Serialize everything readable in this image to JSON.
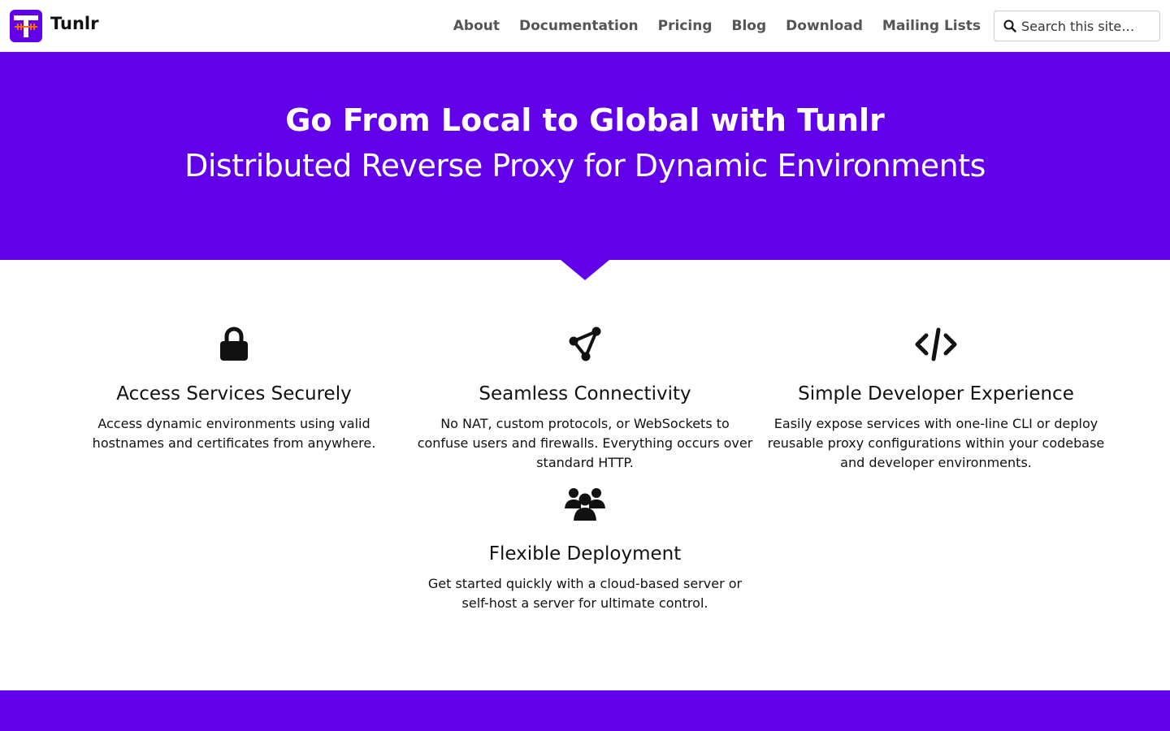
{
  "site": {
    "name": "Tunlr",
    "logo_icon": "tunlr-logo-icon",
    "brand_color": "#6200ea",
    "logo_accent_color": "#ff6d00"
  },
  "nav": {
    "items": [
      {
        "label": "About"
      },
      {
        "label": "Documentation"
      },
      {
        "label": "Pricing"
      },
      {
        "label": "Blog"
      },
      {
        "label": "Download"
      },
      {
        "label": "Mailing Lists"
      }
    ]
  },
  "search": {
    "placeholder": "Search this site…",
    "icon": "search-icon"
  },
  "hero": {
    "title": "Go From Local to Global with Tunlr",
    "subtitle": "Distributed Reverse Proxy for Dynamic Environments"
  },
  "features": [
    {
      "icon": "lock-icon",
      "title": "Access Services Securely",
      "text": "Access dynamic environments using valid hostnames and certificates from anywhere."
    },
    {
      "icon": "connectivity-icon",
      "title": "Seamless Connectivity",
      "text": "No NAT, custom protocols, or WebSockets to confuse users and firewalls. Everything occurs over standard HTTP."
    },
    {
      "icon": "code-icon",
      "title": "Simple Developer Experience",
      "text": "Easily expose services with one-line CLI or deploy reusable proxy configurations within your codebase and developer environments."
    },
    {
      "icon": "users-icon",
      "title": "Flexible Deployment",
      "text": "Get started quickly with a cloud-based server or self-host a server for ultimate control."
    }
  ]
}
